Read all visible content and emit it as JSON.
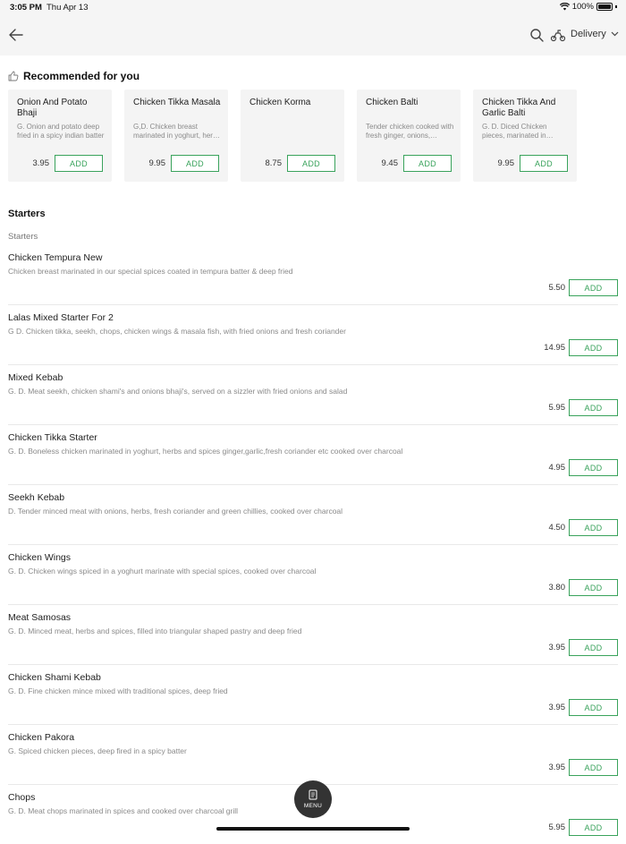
{
  "status": {
    "time": "3:05 PM",
    "date": "Thu Apr 13",
    "battery": "100%"
  },
  "topbar": {
    "delivery_label": "Delivery"
  },
  "recommended": {
    "title": "Recommended for you",
    "items": [
      {
        "name": "Onion And Potato Bhaji",
        "desc": "G. Onion and potato deep fried in a spicy indian batter",
        "price": "3.95",
        "add": "ADD"
      },
      {
        "name": "Chicken Tikka Masala",
        "desc": "G,D. Chicken breast marinated in yoghurt, herbs and spices",
        "price": "9.95",
        "add": "ADD"
      },
      {
        "name": "Chicken Korma",
        "desc": "",
        "price": "8.75",
        "add": "ADD"
      },
      {
        "name": "Chicken Balti",
        "desc": "Tender chicken cooked with fresh ginger, onions, peppers",
        "price": "9.45",
        "add": "ADD"
      },
      {
        "name": "Chicken Tikka And Garlic Balti",
        "desc": "G. D. Diced Chicken pieces, marinated in yoghurt, herbs",
        "price": "9.95",
        "add": "ADD"
      }
    ]
  },
  "section": {
    "title": "Starters",
    "subtitle": "Starters"
  },
  "items": [
    {
      "name": "Chicken Tempura New",
      "desc": "Chicken breast marinated in our special spices coated in tempura batter & deep fried",
      "price": "5.50",
      "add": "ADD"
    },
    {
      "name": "Lalas Mixed Starter For 2",
      "desc": "G D. Chicken tikka, seekh, chops, chicken wings & masala fish, with fried onions and fresh coriander",
      "price": "14.95",
      "add": "ADD"
    },
    {
      "name": "Mixed Kebab",
      "desc": "G. D. Meat seekh, chicken shami's and onions bhaji's, served on a sizzler with fried onions and salad",
      "price": "5.95",
      "add": "ADD"
    },
    {
      "name": "Chicken Tikka Starter",
      "desc": "G. D. Boneless chicken marinated in yoghurt, herbs and spices ginger,garlic,fresh coriander etc cooked over charcoal",
      "price": "4.95",
      "add": "ADD"
    },
    {
      "name": "Seekh Kebab",
      "desc": "D. Tender minced meat with onions, herbs, fresh coriander and green chillies, cooked over charcoal",
      "price": "4.50",
      "add": "ADD"
    },
    {
      "name": "Chicken Wings",
      "desc": "G. D. Chicken wings spiced in a yoghurt marinate with special spices, cooked over charcoal",
      "price": "3.80",
      "add": "ADD"
    },
    {
      "name": "Meat Samosas",
      "desc": "G. D. Minced meat, herbs and spices, filled into triangular shaped pastry and deep fried",
      "price": "3.95",
      "add": "ADD"
    },
    {
      "name": "Chicken Shami Kebab",
      "desc": "G. D. Fine chicken mince mixed with traditional spices, deep fried",
      "price": "3.95",
      "add": "ADD"
    },
    {
      "name": "Chicken Pakora",
      "desc": "G. Spiced chicken pieces, deep fired in a spicy batter",
      "price": "3.95",
      "add": "ADD"
    },
    {
      "name": "Chops",
      "desc": "G. D. Meat chops marinated in spices and cooked over charcoal grill",
      "price": "5.95",
      "add": "ADD"
    }
  ],
  "menu_button": {
    "label": "MENU"
  },
  "colors": {
    "accent": "#3aa35c",
    "fab": "#333333",
    "header_bg": "#f5f5f5"
  }
}
